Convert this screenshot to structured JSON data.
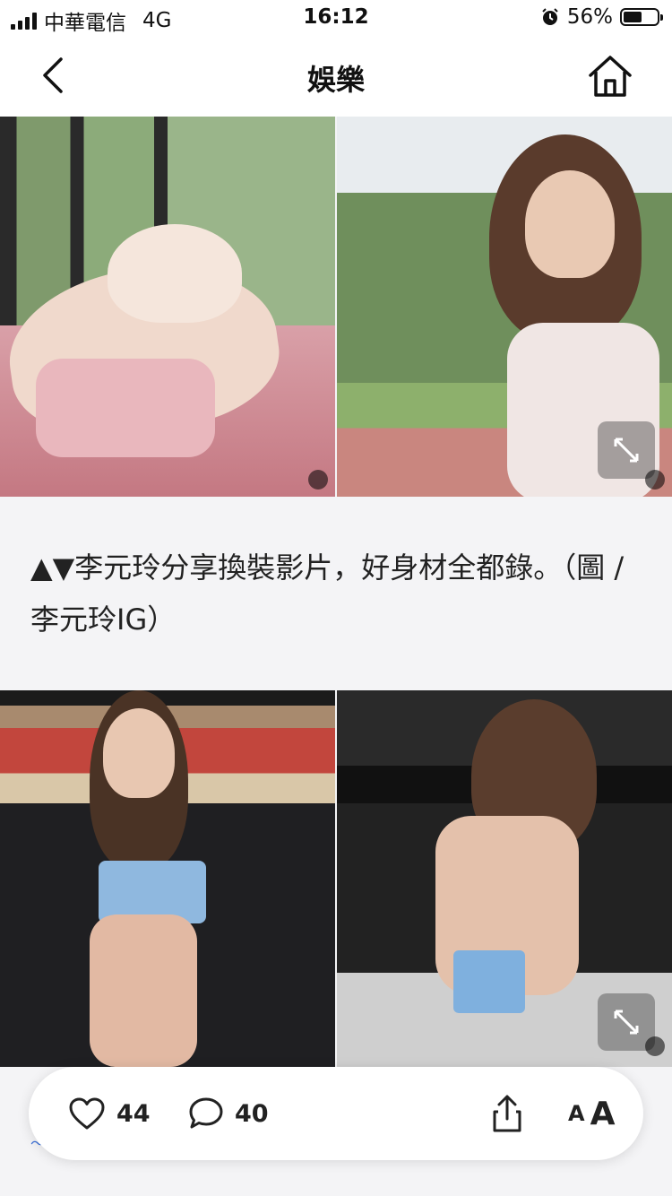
{
  "status_bar": {
    "carrier": "中華電信",
    "network": "4G",
    "time": "16:12",
    "battery_percent": "56%",
    "battery_level": 0.56
  },
  "nav": {
    "title": "娛樂",
    "back_icon": "chevron-left-icon",
    "home_icon": "home-icon"
  },
  "caption": {
    "text": "▲▼李元玲分享換裝影片，好身材全都錄。（圖 / 李元玲IG）"
  },
  "actions": {
    "like_count": "44",
    "comment_count": "40",
    "font_label": "A"
  },
  "colors": {
    "page_bg": "#f4f4f6",
    "bar_bg": "#ffffff",
    "peek_accent": "#3a6fd8"
  }
}
